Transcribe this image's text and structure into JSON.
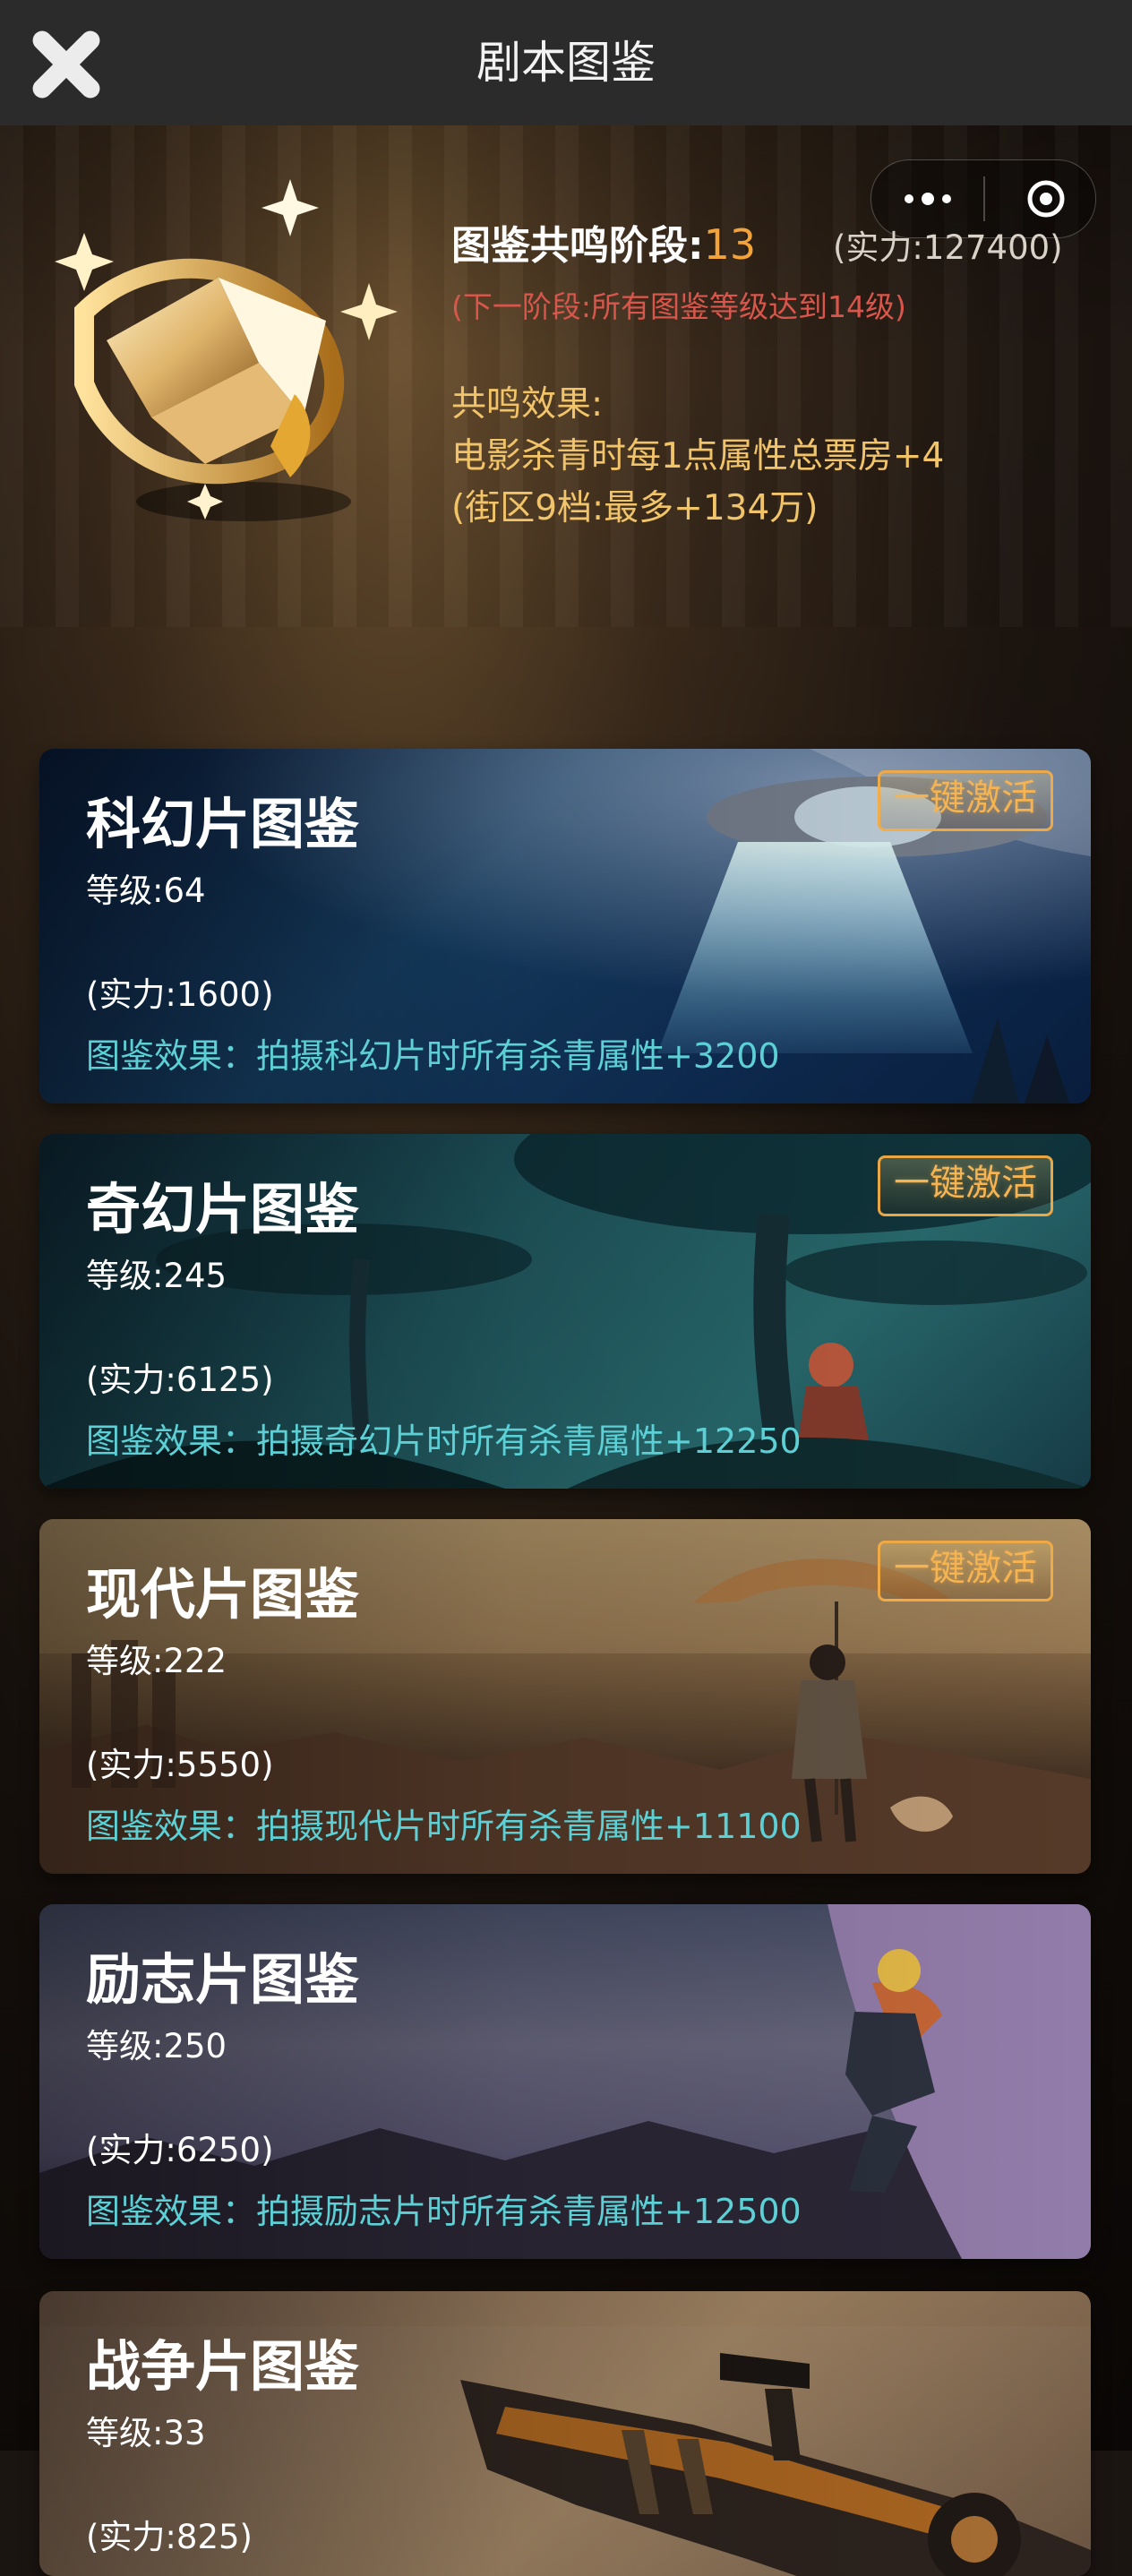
{
  "header": {
    "title": "剧本图鉴"
  },
  "overview": {
    "resonance_label": "图鉴共鸣阶段:",
    "resonance_stage": "13",
    "total_power": "(实力:127400)",
    "next_stage": "(下一阶段:所有图鉴等级达到14级)",
    "effect_title": "共鸣效果:",
    "effect_line_1": "电影杀青时每1点属性总票房+4",
    "effect_line_2": "(街区9档:最多+134万)"
  },
  "cards": [
    {
      "title": "科幻片图鉴",
      "level": "等级:64",
      "power": "(实力:1600)",
      "effect": "图鉴效果：拍摄科幻片时所有杀青属性+3200",
      "button": "一键激活"
    },
    {
      "title": "奇幻片图鉴",
      "level": "等级:245",
      "power": "(实力:6125)",
      "effect": "图鉴效果：拍摄奇幻片时所有杀青属性+12250",
      "button": "一键激活"
    },
    {
      "title": "现代片图鉴",
      "level": "等级:222",
      "power": "(实力:5550)",
      "effect": "图鉴效果：拍摄现代片时所有杀青属性+11100",
      "button": "一键激活"
    },
    {
      "title": "励志片图鉴",
      "level": "等级:250",
      "power": "(实力:6250)",
      "effect": "图鉴效果：拍摄励志片时所有杀青属性+12500"
    },
    {
      "title": "战争片图鉴",
      "level": "等级:33",
      "power": "(实力:825)"
    }
  ],
  "icons": {
    "close": "close-icon",
    "more": "more-icon",
    "target": "target-icon",
    "book": "book-icon"
  }
}
